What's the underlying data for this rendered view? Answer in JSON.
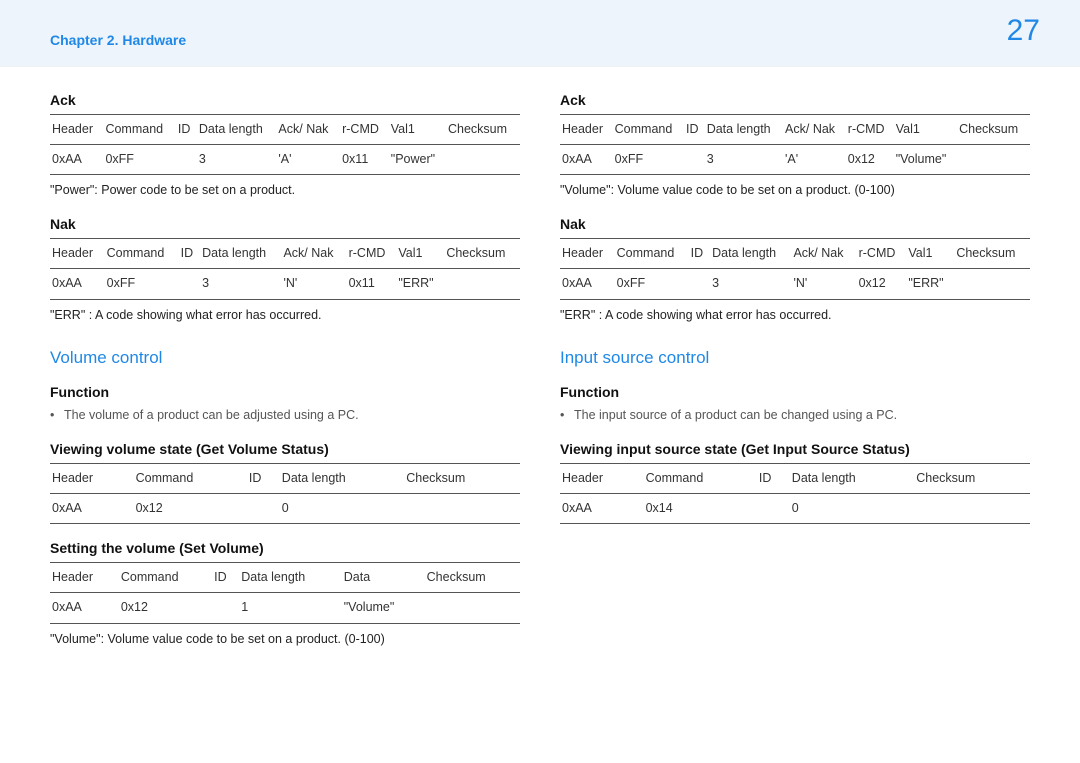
{
  "header": {
    "chapter": "Chapter 2. Hardware",
    "page": "27"
  },
  "left": {
    "ackTitle": "Ack",
    "ackTable": {
      "h1": "Header",
      "h2": "Command",
      "h3": "ID",
      "h4": "Data length",
      "h5": "Ack/ Nak",
      "h6": "r-CMD",
      "h7": "Val1",
      "h8": "Checksum",
      "r1": "0xAA",
      "r2": "0xFF",
      "r3": "",
      "r4": "3",
      "r5": "'A'",
      "r6": "0x11",
      "r7": "\"Power\"",
      "r8": ""
    },
    "ackNote": "\"Power\": Power code to be set on a product.",
    "nakTitle": "Nak",
    "nakTable": {
      "h1": "Header",
      "h2": "Command",
      "h3": "ID",
      "h4": "Data length",
      "h5": "Ack/ Nak",
      "h6": "r-CMD",
      "h7": "Val1",
      "h8": "Checksum",
      "r1": "0xAA",
      "r2": "0xFF",
      "r3": "",
      "r4": "3",
      "r5": "'N'",
      "r6": "0x11",
      "r7": "\"ERR\"",
      "r8": ""
    },
    "nakNote": "\"ERR\" : A code showing what error has occurred.",
    "volTitle": "Volume control",
    "funcTitle": "Function",
    "funcBullet": "The volume of a product can be adjusted using a PC.",
    "viewTitle": "Viewing volume state (Get Volume Status)",
    "viewTable": {
      "h1": "Header",
      "h2": "Command",
      "h3": "ID",
      "h4": "Data length",
      "h5": "Checksum",
      "r1": "0xAA",
      "r2": "0x12",
      "r3": "",
      "r4": "0",
      "r5": ""
    },
    "setTitle": "Setting the volume (Set Volume)",
    "setTable": {
      "h1": "Header",
      "h2": "Command",
      "h3": "ID",
      "h4": "Data length",
      "h5": "Data",
      "h6": "Checksum",
      "r1": "0xAA",
      "r2": "0x12",
      "r3": "",
      "r4": "1",
      "r5": "\"Volume\"",
      "r6": ""
    },
    "setNote": "\"Volume\": Volume value code to be set on a product. (0-100)"
  },
  "right": {
    "ackTitle": "Ack",
    "ackTable": {
      "h1": "Header",
      "h2": "Command",
      "h3": "ID",
      "h4": "Data length",
      "h5": "Ack/ Nak",
      "h6": "r-CMD",
      "h7": "Val1",
      "h8": "Checksum",
      "r1": "0xAA",
      "r2": "0xFF",
      "r3": "",
      "r4": "3",
      "r5": "'A'",
      "r6": "0x12",
      "r7": "\"Volume\"",
      "r8": ""
    },
    "ackNote": "\"Volume\": Volume value code to be set on a product. (0-100)",
    "nakTitle": "Nak",
    "nakTable": {
      "h1": "Header",
      "h2": "Command",
      "h3": "ID",
      "h4": "Data length",
      "h5": "Ack/ Nak",
      "h6": "r-CMD",
      "h7": "Val1",
      "h8": "Checksum",
      "r1": "0xAA",
      "r2": "0xFF",
      "r3": "",
      "r4": "3",
      "r5": "'N'",
      "r6": "0x12",
      "r7": "\"ERR\"",
      "r8": ""
    },
    "nakNote": "\"ERR\" : A code showing what error has occurred.",
    "inputTitle": "Input source control",
    "funcTitle": "Function",
    "funcBullet": "The input source of a product can be changed using a PC.",
    "viewTitle": "Viewing input source state (Get Input Source Status)",
    "viewTable": {
      "h1": "Header",
      "h2": "Command",
      "h3": "ID",
      "h4": "Data length",
      "h5": "Checksum",
      "r1": "0xAA",
      "r2": "0x14",
      "r3": "",
      "r4": "0",
      "r5": ""
    }
  }
}
